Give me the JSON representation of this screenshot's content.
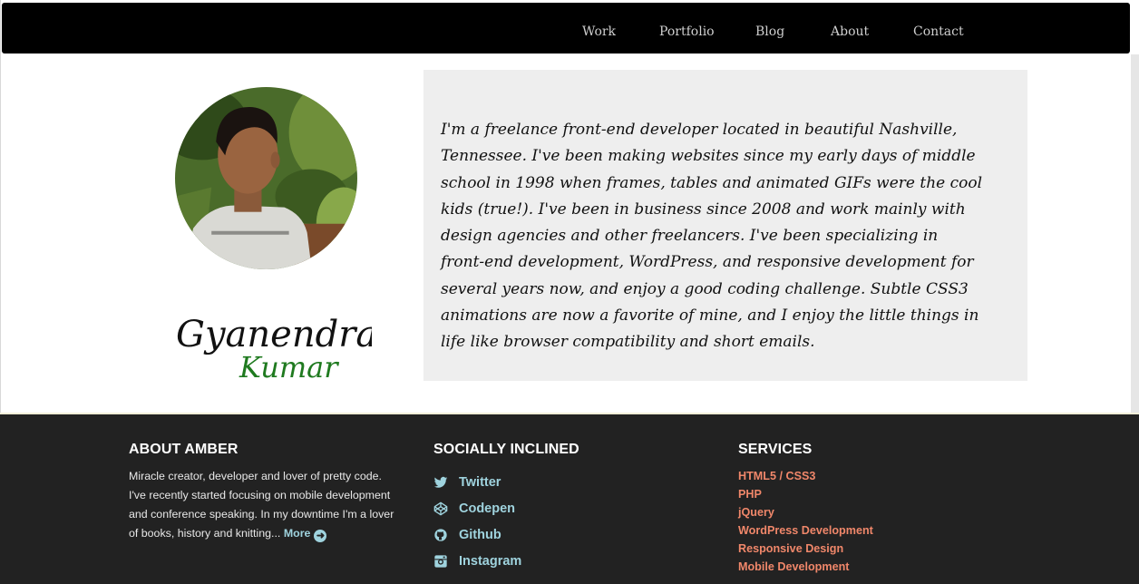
{
  "nav": {
    "items": [
      {
        "label": "Work"
      },
      {
        "label": "Portfolio"
      },
      {
        "label": "Blog"
      },
      {
        "label": "About"
      },
      {
        "label": "Contact"
      }
    ]
  },
  "profile": {
    "first_name": "Gyanendra",
    "last_name": "Kumar",
    "name_color": "#1f7a1f"
  },
  "bio": {
    "text": "I'm a freelance front-end developer located in beautiful Nashville, Tennessee. I've been making websites since my early days of middle school in 1998 when frames, tables and animated GIFs were the cool kids (true!). I've been in business since 2008 and work mainly with design agencies and other freelancers. I've been specializing in front-end development, WordPress, and responsive development for several years now, and enjoy a good coding challenge. Subtle CSS3 animations are now a favorite of mine, and I enjoy the little things in life like browser compatibility and short emails."
  },
  "footer": {
    "about": {
      "heading": "ABOUT AMBER",
      "text": "Miracle creator, developer and lover of pretty code. I've recently started focusing on mobile development and conference speaking. In my downtime I'm a lover of books, history and knitting...",
      "more_label": "More"
    },
    "social": {
      "heading": "SOCIALLY INCLINED",
      "items": [
        {
          "label": "Twitter",
          "icon": "twitter-icon"
        },
        {
          "label": "Codepen",
          "icon": "codepen-icon"
        },
        {
          "label": "Github",
          "icon": "github-icon"
        },
        {
          "label": "Instagram",
          "icon": "instagram-icon"
        }
      ]
    },
    "services": {
      "heading": "SERVICES",
      "items": [
        {
          "label": "HTML5 / CSS3"
        },
        {
          "label": "PHP"
        },
        {
          "label": "jQuery"
        },
        {
          "label": "WordPress Development"
        },
        {
          "label": "Responsive Design"
        },
        {
          "label": "Mobile Development"
        }
      ]
    }
  },
  "colors": {
    "nav_bg": "#000000",
    "footer_bg": "#222222",
    "link_blue": "#9fd3de",
    "service_orange": "#f0876a",
    "bio_bg": "#eeeeee"
  }
}
